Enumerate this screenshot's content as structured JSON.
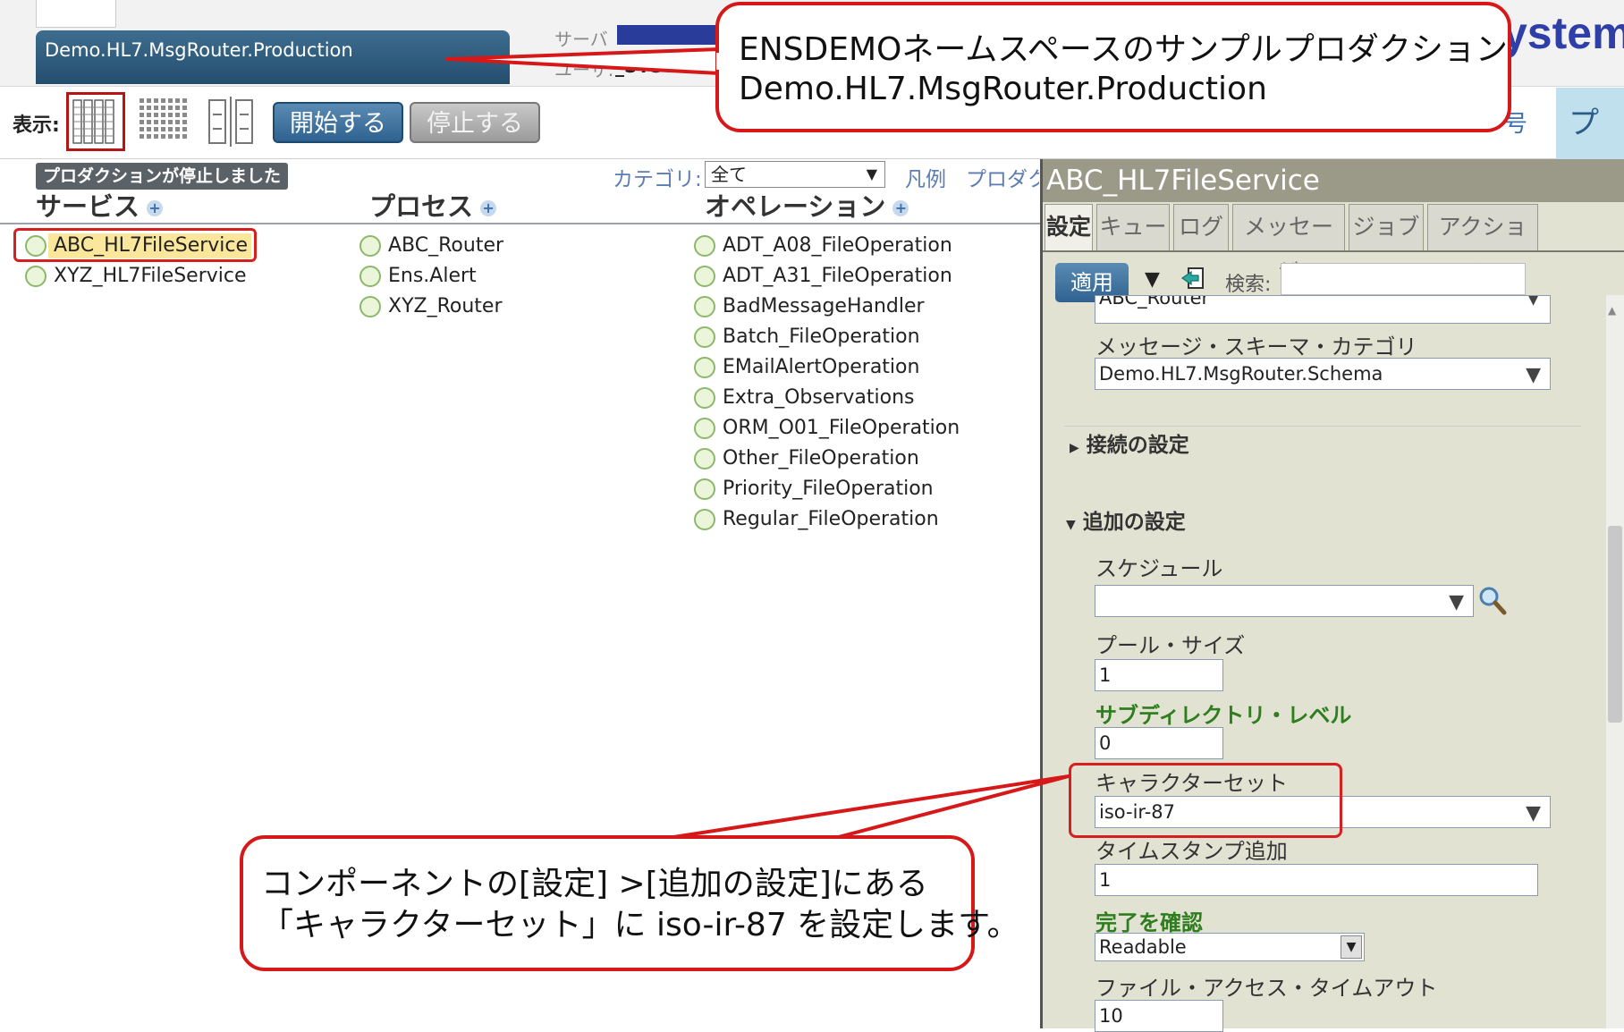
{
  "header": {
    "production_title": "Demo.HL7.MsgRouter.Production",
    "server_label": "サーバ",
    "user_label": "ユーザ:",
    "user_value": "_SYSTEM",
    "brand_text": "ystem"
  },
  "toolbar": {
    "display_label": "表示:",
    "start_label": "開始する",
    "stop_label": "停止する",
    "top_right_text": "号",
    "top_right_tab": "プロ"
  },
  "production": {
    "status": "プロダクションが停止しました",
    "category_label": "カテゴリ:",
    "category_value": "全て",
    "legend_link": "凡例",
    "production_link": "プロダク",
    "columns": {
      "services": "サービス",
      "processes": "プロセス",
      "operations": "オペレーション"
    },
    "services": [
      "ABC_HL7FileService",
      "XYZ_HL7FileService"
    ],
    "processes": [
      "ABC_Router",
      "Ens.Alert",
      "XYZ_Router"
    ],
    "operations": [
      "ADT_A08_FileOperation",
      "ADT_A31_FileOperation",
      "BadMessageHandler",
      "Batch_FileOperation",
      "EMailAlertOperation",
      "Extra_Observations",
      "ORM_O01_FileOperation",
      "Other_FileOperation",
      "Priority_FileOperation",
      "Regular_FileOperation"
    ]
  },
  "detail_panel": {
    "title": "ABC_HL7FileService",
    "tabs": [
      "設定",
      "キュー",
      "ログ",
      "メッセージ",
      "ジョブ",
      "アクション"
    ],
    "apply_label": "適用",
    "search_label": "検索:",
    "search_value": "",
    "router_value": "ABC_Router",
    "schema_label": "メッセージ・スキーマ・カテゴリ",
    "schema_value": "Demo.HL7.MsgRouter.Schema",
    "connection_section": "接続の設定",
    "extra_section": "追加の設定",
    "schedule_label": "スケジュール",
    "schedule_value": "",
    "pool_label": "プール・サイズ",
    "pool_value": "1",
    "subdir_label": "サブディレクトリ・レベル",
    "subdir_value": "0",
    "charset_label": "キャラクターセット",
    "charset_value": "iso-ir-87",
    "timestamp_label": "タイムスタンプ追加",
    "timestamp_value": "1",
    "confirm_label": "完了を確認",
    "confirm_value": "Readable",
    "timeout_label": "ファイル・アクセス・タイムアウト",
    "timeout_value": "10"
  },
  "callouts": {
    "top_line1": "ENSDEMOネームスペースのサンプルプロダクション",
    "top_line2": "Demo.HL7.MsgRouter.Production",
    "bottom_line1": "コンポーネントの[設定] >[追加の設定]にある",
    "bottom_line2": "「キャラクターセット」に iso-ir-87 を設定します。"
  },
  "colors": {
    "highlight_red": "#d61818",
    "accent_blue": "#2f6290",
    "brand_blue": "#2f3fa8",
    "status_green_dot": "#8bb86a"
  }
}
